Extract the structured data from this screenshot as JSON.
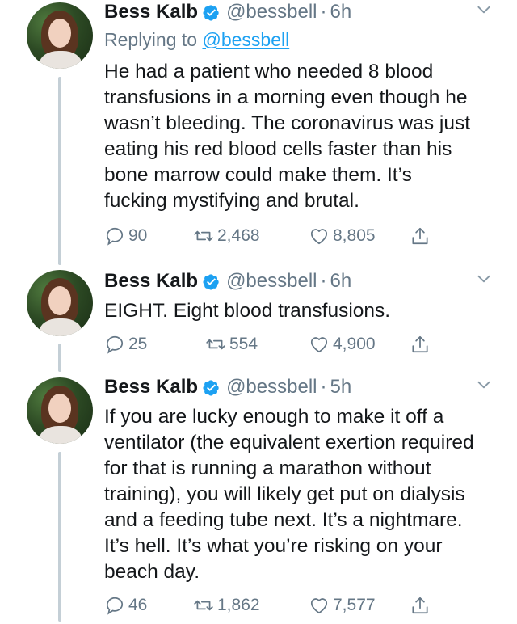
{
  "tweets": [
    {
      "name": "Bess Kalb",
      "handle": "@bessbell",
      "dot": "·",
      "time": "6h",
      "reply_prefix": "Replying to ",
      "reply_handle": "@bessbell",
      "text": "He had a patient who needed 8 blood\ntransfusions in a morning even though he\nwasn’t bleeding. The coronavirus was just\neating his red blood cells faster than his\nbone marrow could make them. It’s\nfucking mystifying and brutal.",
      "replies": "90",
      "retweets": "2,468",
      "likes": "8,805"
    },
    {
      "name": "Bess Kalb",
      "handle": "@bessbell",
      "dot": "·",
      "time": "6h",
      "text": "EIGHT. Eight blood transfusions.",
      "replies": "25",
      "retweets": "554",
      "likes": "4,900"
    },
    {
      "name": "Bess Kalb",
      "handle": "@bessbell",
      "dot": "·",
      "time": "5h",
      "text": "If you are lucky enough to make it off a\nventilator (the equivalent exertion required\nfor that is running a marathon without\ntraining), you will likely get put on dialysis\nand a feeding tube next. It’s a nightmare.\nIt’s hell. It’s what you’re risking on your\nbeach day.",
      "replies": "46",
      "retweets": "1,862",
      "likes": "7,577"
    }
  ],
  "icons": {
    "verified": "verified-badge-icon",
    "chevron": "chevron-down-icon",
    "reply": "reply-icon",
    "retweet": "retweet-icon",
    "like": "heart-icon",
    "share": "share-icon"
  },
  "colors": {
    "text": "#14171a",
    "secondary": "#657786",
    "link": "#1da1f2",
    "verified": "#1da1f2",
    "thread_line": "#c4cfd6"
  }
}
